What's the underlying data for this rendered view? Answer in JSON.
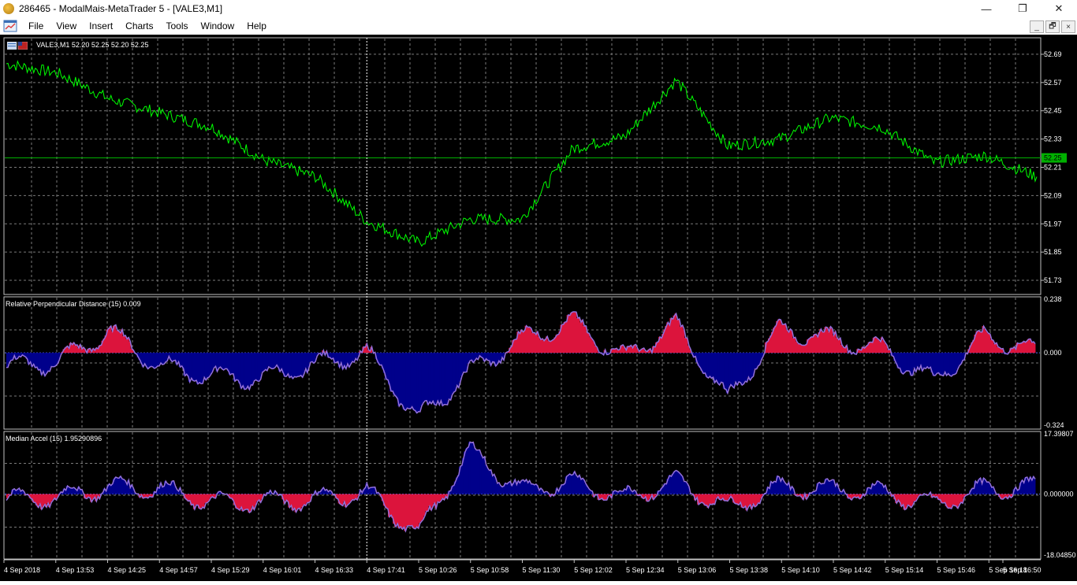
{
  "window": {
    "title": "286465 - ModalMais-MetaTrader 5 - [VALE3,M1]",
    "controls": [
      "—",
      "❐",
      "✕"
    ]
  },
  "menu": [
    "File",
    "View",
    "Insert",
    "Charts",
    "Tools",
    "Window",
    "Help"
  ],
  "mdi_controls": [
    "_",
    "🗗",
    "×"
  ],
  "main_chart": {
    "label": "VALE3,M1  52.20 52.25 52.20 52.25",
    "current_price": "52.25",
    "price_ticks": [
      "52.69",
      "52.57",
      "52.45",
      "52.33",
      "52.21",
      "52.09",
      "51.97",
      "51.85",
      "51.73"
    ]
  },
  "indicator1": {
    "label": "Relative Perpendicular Distance (15) 0.009",
    "ticks": [
      "0.238",
      "0.000",
      "-0.324"
    ]
  },
  "indicator2": {
    "label": "Median Accel (15) 1.95290896",
    "ticks": [
      "17.39807",
      "0.000000",
      "-18.04850"
    ]
  },
  "time_labels": [
    "4 Sep 2018",
    "4 Sep 13:53",
    "4 Sep 14:25",
    "4 Sep 14:57",
    "4 Sep 15:29",
    "4 Sep 16:01",
    "4 Sep 16:33",
    "4 Sep 17:41",
    "5 Sep 10:26",
    "5 Sep 10:58",
    "5 Sep 11:30",
    "5 Sep 12:02",
    "5 Sep 12:34",
    "5 Sep 13:06",
    "5 Sep 13:38",
    "5 Sep 14:10",
    "5 Sep 14:42",
    "5 Sep 15:14",
    "5 Sep 15:46",
    "5 Sep 16:18",
    "5 Sep 16:50"
  ],
  "chart_data": [
    {
      "type": "line",
      "title": "VALE3,M1",
      "x": [
        "4 Sep 2018",
        "4 Sep 13:53",
        "4 Sep 14:25",
        "4 Sep 14:57",
        "4 Sep 15:29",
        "4 Sep 16:01",
        "4 Sep 16:33",
        "4 Sep 17:41",
        "5 Sep 10:26",
        "5 Sep 10:58",
        "5 Sep 11:30",
        "5 Sep 12:02",
        "5 Sep 12:34",
        "5 Sep 13:06",
        "5 Sep 13:38",
        "5 Sep 14:10",
        "5 Sep 14:42",
        "5 Sep 15:14",
        "5 Sep 15:46",
        "5 Sep 16:18",
        "5 Sep 16:50"
      ],
      "values": [
        52.65,
        52.61,
        52.5,
        52.44,
        52.38,
        52.24,
        52.17,
        51.98,
        51.89,
        51.99,
        51.99,
        52.29,
        52.34,
        52.58,
        52.3,
        52.33,
        52.42,
        52.38,
        52.23,
        52.26,
        52.17
      ],
      "ylim": [
        51.67,
        52.76
      ],
      "grid": true,
      "color": "#00ff00"
    },
    {
      "type": "area",
      "title": "Relative Perpendicular Distance (15) 0.009",
      "x": [
        "4 Sep 2018",
        "4 Sep 13:53",
        "4 Sep 14:25",
        "4 Sep 14:57",
        "4 Sep 15:29",
        "4 Sep 16:01",
        "4 Sep 16:33",
        "4 Sep 17:41",
        "5 Sep 10:26",
        "5 Sep 10:58",
        "5 Sep 11:30",
        "5 Sep 12:02",
        "5 Sep 12:34",
        "5 Sep 13:06",
        "5 Sep 13:38",
        "5 Sep 14:10",
        "5 Sep 14:42",
        "5 Sep 15:14",
        "5 Sep 15:46",
        "5 Sep 16:18",
        "5 Sep 16:50"
      ],
      "values": [
        -0.06,
        -0.04,
        0.09,
        -0.06,
        -0.1,
        -0.11,
        -0.05,
        0.0,
        -0.28,
        -0.08,
        0.06,
        0.13,
        -0.02,
        0.12,
        -0.2,
        0.1,
        0.06,
        0.02,
        -0.12,
        0.07,
        0.009
      ],
      "ylim": [
        -0.324,
        0.238
      ],
      "positive_color": "#dc143c",
      "negative_color": "#00008b",
      "line_color": "#9370db"
    },
    {
      "type": "area",
      "title": "Median Accel (15) 1.95290896",
      "x": [
        "4 Sep 2018",
        "4 Sep 13:53",
        "4 Sep 14:25",
        "4 Sep 14:57",
        "4 Sep 15:29",
        "4 Sep 16:01",
        "4 Sep 16:33",
        "4 Sep 17:41",
        "5 Sep 10:26",
        "5 Sep 10:58",
        "5 Sep 11:30",
        "5 Sep 12:02",
        "5 Sep 12:34",
        "5 Sep 13:06",
        "5 Sep 13:38",
        "5 Sep 14:10",
        "5 Sep 14:42",
        "5 Sep 15:14",
        "5 Sep 15:46",
        "5 Sep 16:18",
        "5 Sep 16:50"
      ],
      "values": [
        -1.5,
        -1.0,
        2.0,
        1.5,
        -2.5,
        -2.0,
        -1.5,
        0.5,
        -11.0,
        12.0,
        1.0,
        3.5,
        -1.0,
        3.5,
        -4.0,
        2.0,
        1.5,
        0.5,
        -3.0,
        1.5,
        1.95
      ],
      "ylim": [
        -18.0485,
        17.39807
      ],
      "positive_color": "#00008b",
      "negative_color": "#dc143c",
      "line_color": "#9370db"
    }
  ]
}
